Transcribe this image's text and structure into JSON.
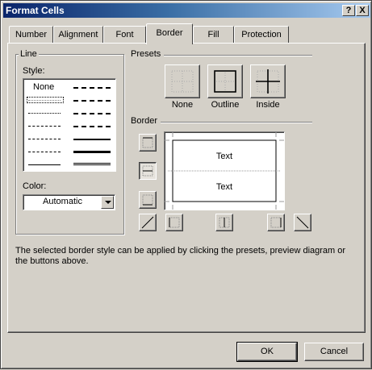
{
  "window": {
    "title": "Format Cells",
    "help_glyph": "?",
    "close_glyph": "X"
  },
  "tabs": [
    {
      "label": "Number",
      "active": false
    },
    {
      "label": "Alignment",
      "active": false
    },
    {
      "label": "Font",
      "active": false
    },
    {
      "label": "Border",
      "active": true
    },
    {
      "label": "Fill",
      "active": false
    },
    {
      "label": "Protection",
      "active": false
    }
  ],
  "line_group": {
    "title": "Line",
    "style_label": "Style:",
    "none_label": "None",
    "color_label": "Color:",
    "color_value": "Automatic"
  },
  "presets": {
    "title": "Presets",
    "none": "None",
    "outline": "Outline",
    "inside": "Inside"
  },
  "border": {
    "title": "Border",
    "preview_text_top": "Text",
    "preview_text_bottom": "Text"
  },
  "description": "The selected border style can be applied by clicking the presets, preview diagram or the buttons above.",
  "buttons": {
    "ok": "OK",
    "cancel": "Cancel"
  },
  "colors": {
    "dialog_bg": "#d4d0c8",
    "titlebar_start": "#0a246a",
    "titlebar_end": "#a6caf0"
  }
}
